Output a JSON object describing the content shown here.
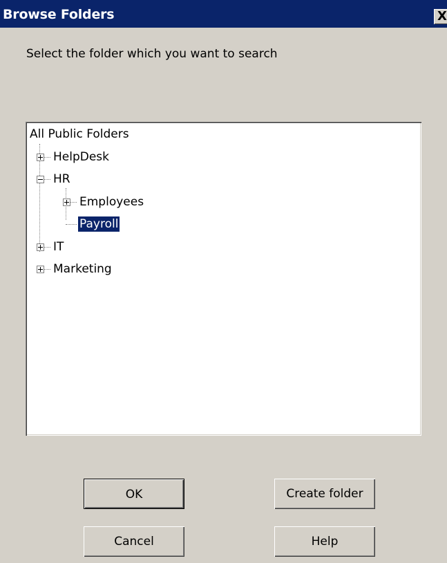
{
  "window": {
    "title": "Browse Folders",
    "close_label": "X"
  },
  "prompt": "Select the folder which you want to search",
  "tree": {
    "root": "All Public Folders",
    "items": [
      {
        "label": "HelpDesk",
        "expander": "plus"
      },
      {
        "label": "HR",
        "expander": "minus"
      },
      {
        "label": "Employees",
        "expander": "plus"
      },
      {
        "label": "Payroll",
        "selected": true
      },
      {
        "label": "IT",
        "expander": "plus"
      },
      {
        "label": "Marketing",
        "expander": "plus"
      }
    ],
    "selected_color": "#0a246a"
  },
  "buttons": {
    "ok": "OK",
    "create_folder": "Create folder",
    "cancel": "Cancel",
    "help": "Help"
  }
}
